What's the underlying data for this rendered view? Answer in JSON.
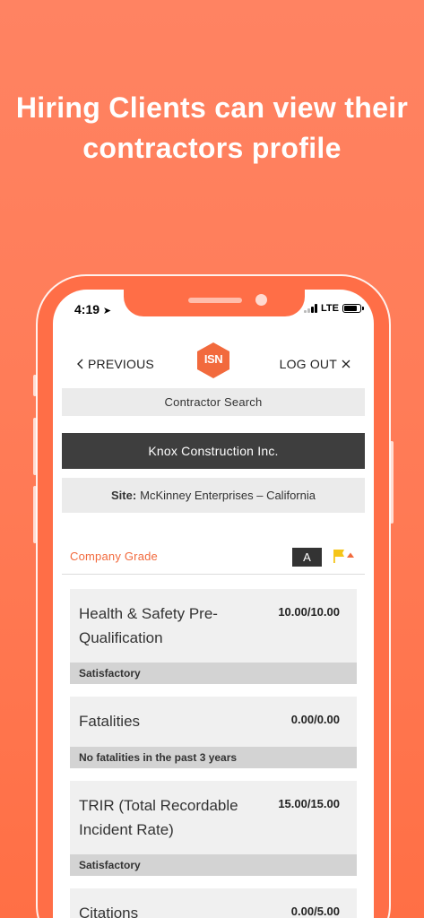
{
  "headline": {
    "line1": "Hiring Clients can view their",
    "line2": "contractors profile"
  },
  "status_bar": {
    "time": "4:19",
    "network": "LTE",
    "location_icon": "location-arrow-icon"
  },
  "nav": {
    "previous_label": "PREVIOUS",
    "logout_label": "LOG OUT",
    "logo_text": "ISN"
  },
  "search": {
    "label": "Contractor Search"
  },
  "company": {
    "name": "Knox Construction Inc."
  },
  "site": {
    "label": "Site:",
    "value": "McKinney Enterprises – California"
  },
  "grade": {
    "label": "Company Grade",
    "value": "A",
    "flag_color": "#f5c518"
  },
  "cards": [
    {
      "title_line1": "Health & Safety Pre-",
      "title_line2": "Qualification",
      "score": "10.00/10.00",
      "status": "Satisfactory"
    },
    {
      "title_line1": "Fatalities",
      "score": "0.00/0.00",
      "status": "No fatalities in the past 3 years"
    },
    {
      "title_line1": "TRIR (Total Recordable",
      "title_line2": "Incident Rate)",
      "score": "15.00/15.00",
      "status": "Satisfactory"
    },
    {
      "title_line1": "Citations",
      "score": "0.00/5.00"
    }
  ],
  "colors": {
    "accent": "#f26a3d",
    "background": "#ff7a55",
    "dark_bar": "#3e3e3e"
  }
}
